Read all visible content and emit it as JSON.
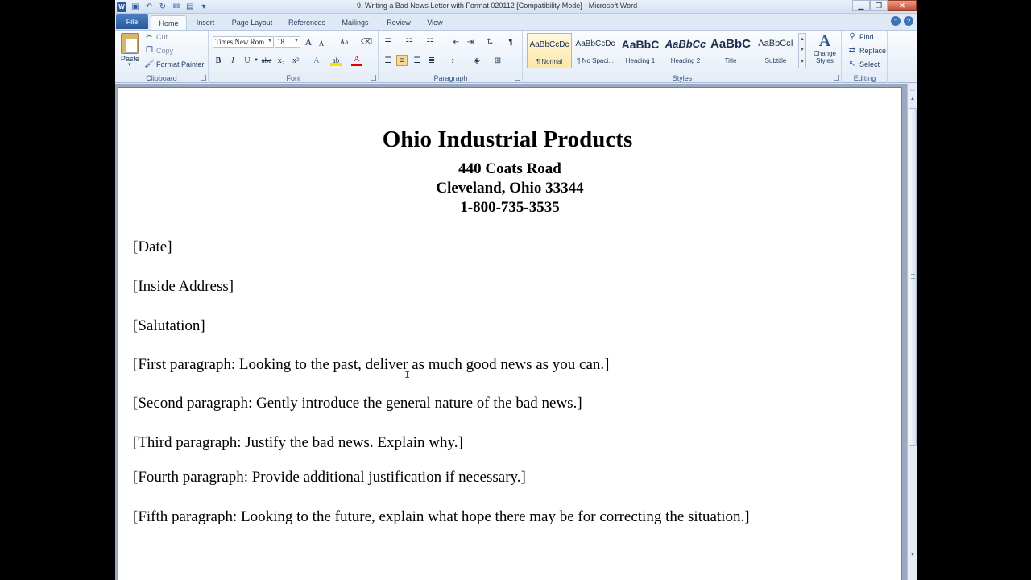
{
  "window": {
    "title": "9. Writing a Bad News Letter with Format 020112 [Compatibility Mode] - Microsoft Word",
    "controls": {
      "minimize": "▁",
      "maximize": "❐",
      "close": "✕"
    }
  },
  "quick_access": {
    "icons": [
      "word-logo-icon",
      "save-icon",
      "undo-icon",
      "redo-icon",
      "email-icon",
      "folder-icon",
      "customize-icon"
    ]
  },
  "tabs": [
    {
      "label": "File"
    },
    {
      "label": "Home"
    },
    {
      "label": "Insert"
    },
    {
      "label": "Page Layout"
    },
    {
      "label": "References"
    },
    {
      "label": "Mailings"
    },
    {
      "label": "Review"
    },
    {
      "label": "View"
    }
  ],
  "ribbon": {
    "clipboard": {
      "label": "Clipboard",
      "paste": "Paste",
      "cut": "Cut",
      "copy": "Copy",
      "format_painter": "Format Painter"
    },
    "font": {
      "label": "Font",
      "font_name": "Times New Rom",
      "font_size": "18",
      "bold": "B",
      "italic": "I",
      "underline": "U",
      "strikethrough": "abc",
      "subscript": "x₂",
      "superscript": "x²",
      "grow": "A",
      "shrink": "A",
      "change_case": "Aa",
      "effects": "A",
      "highlight": "ab",
      "color": "A"
    },
    "paragraph": {
      "label": "Paragraph",
      "show_marks": "¶"
    },
    "styles": {
      "label": "Styles",
      "items": [
        {
          "preview": "AaBbCcDc",
          "name": "¶ Normal"
        },
        {
          "preview": "AaBbCcDc",
          "name": "¶ No Spaci..."
        },
        {
          "preview": "AaBbC",
          "name": "Heading 1"
        },
        {
          "preview": "AaBbCc",
          "name": "Heading 2"
        },
        {
          "preview": "AaBbC",
          "name": "Title"
        },
        {
          "preview": "AaBbCcI",
          "name": "Subtitle"
        }
      ],
      "change_styles": "Change Styles"
    },
    "editing": {
      "label": "Editing",
      "find": "Find",
      "replace": "Replace",
      "select": "Select"
    }
  },
  "document": {
    "company": "Ohio Industrial Products",
    "address_line1": "440 Coats Road",
    "address_line2": "Cleveland, Ohio 33344",
    "phone": "1-800-735-3535",
    "date": "[Date]",
    "inside_address": "[Inside Address]",
    "salutation": "[Salutation]",
    "p1": "[First paragraph: Looking to the past, deliver as much good news as you can.]",
    "p2": "[Second paragraph: Gently introduce the general nature of the bad news.]",
    "p3": "[Third paragraph: Justify the bad news. Explain why.]",
    "p4": "[Fourth paragraph: Provide additional justification if necessary.]",
    "p5": "[Fifth paragraph: Looking to the future, explain what hope there may be for correcting the situation.]"
  },
  "colors": {
    "accent": "#2b5797",
    "ribbon_bg": "#e4ecf7",
    "doc_bg": "#9aa9bf",
    "selected_style": "#fde7a8"
  }
}
